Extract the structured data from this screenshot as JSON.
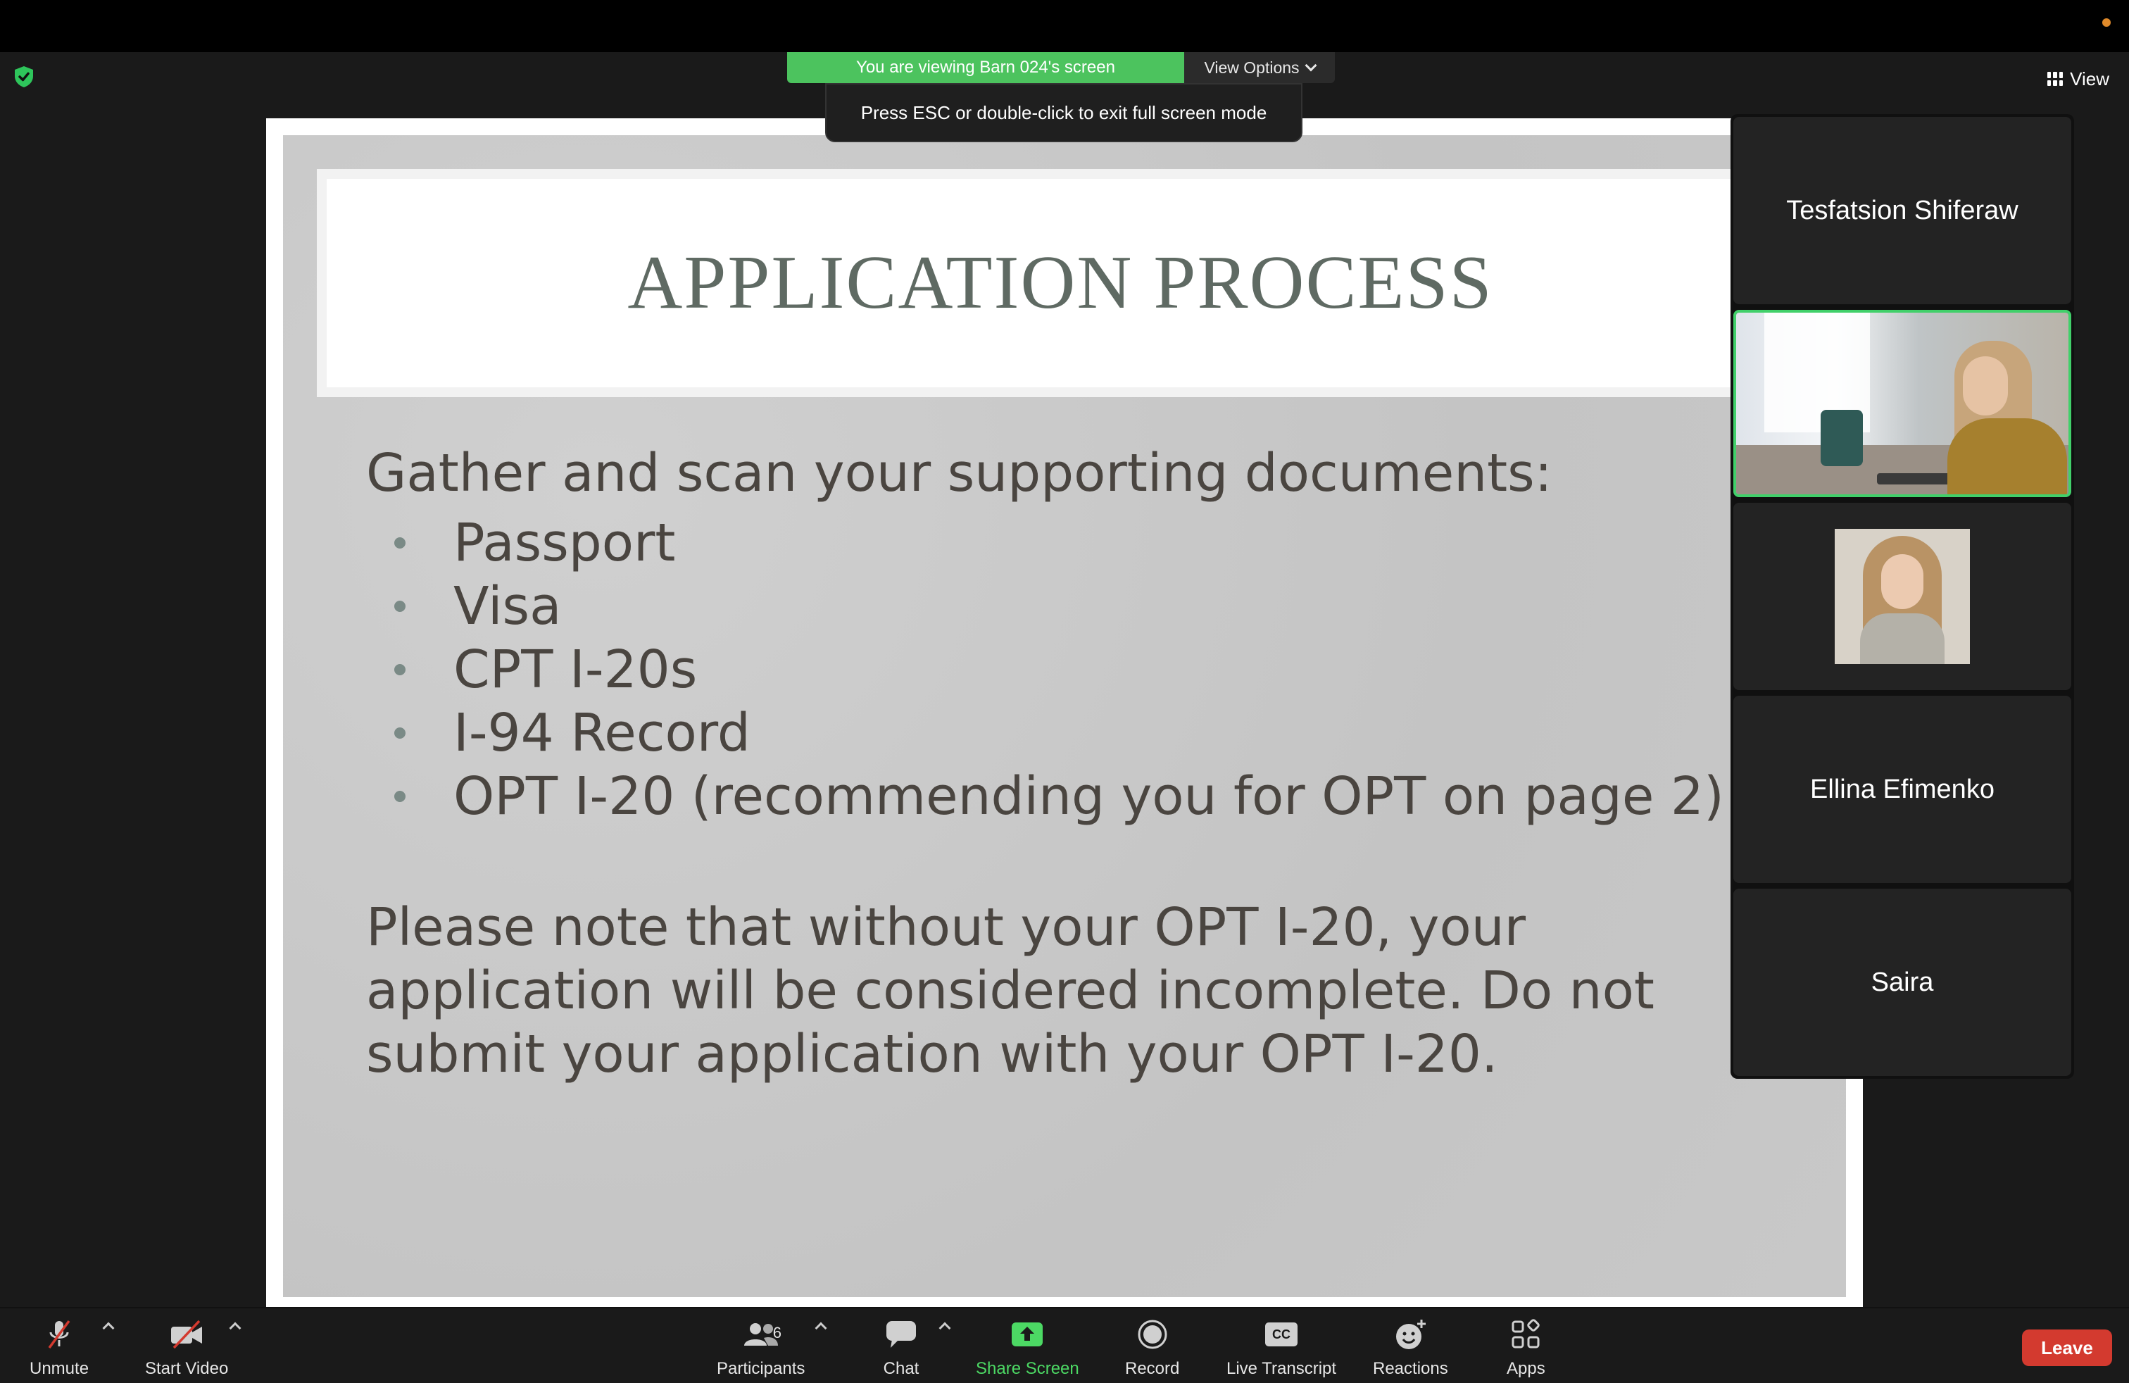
{
  "banner": {
    "viewing_text": "You are viewing Barn 024's screen",
    "options_label": "View Options"
  },
  "toast": {
    "text": "Press ESC or double-click to exit full screen mode"
  },
  "view_button": {
    "label": "View"
  },
  "slide": {
    "title": "APPLICATION PROCESS",
    "lead": "Gather and scan your supporting documents:",
    "bullets": [
      "Passport",
      "Visa",
      "CPT I-20s",
      "I-94 Record",
      "OPT I-20 (recommending you for OPT on page 2)"
    ],
    "note_lines": [
      "Please note that without your OPT I-20, your",
      "application will be considered incomplete. Do not",
      "submit your application with your OPT I-20."
    ]
  },
  "participants": {
    "tile1_name": "Tesfatsion Shiferaw",
    "tile4_name": "Ellina Efimenko",
    "tile5_name": "Saira"
  },
  "toolbar": {
    "unmute": "Unmute",
    "start_video": "Start Video",
    "participants": "Participants",
    "participants_count": "6",
    "chat": "Chat",
    "share_screen": "Share Screen",
    "record": "Record",
    "live_transcript": "Live Transcript",
    "cc_label": "CC",
    "reactions": "Reactions",
    "apps": "Apps",
    "leave": "Leave"
  },
  "colors": {
    "banner_green": "#4cc35e",
    "active_speaker": "#41d06a",
    "share_green": "#4cd964",
    "leave_red": "#d33a2f",
    "slide_title": "#5f6a63",
    "slide_text": "#4a4540"
  },
  "icons": [
    "shield-check-icon",
    "grid-view-icon",
    "chevron-down-icon",
    "mic-muted-icon",
    "video-off-icon",
    "participants-icon",
    "chat-icon",
    "share-screen-icon",
    "record-icon",
    "cc-icon",
    "reactions-icon",
    "apps-icon"
  ]
}
